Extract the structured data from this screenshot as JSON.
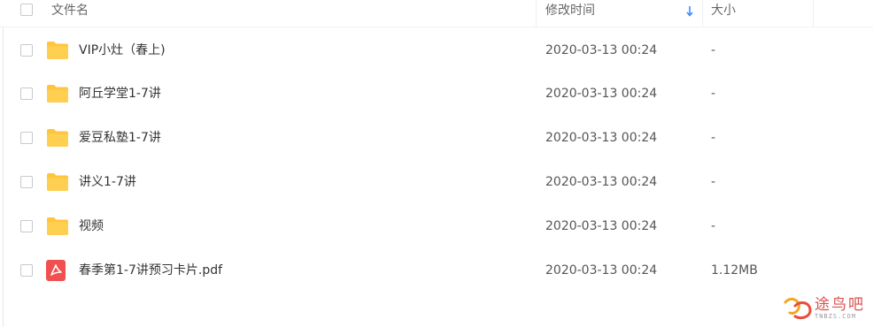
{
  "header": {
    "col_name": "文件名",
    "col_modified": "修改时间",
    "col_size": "大小"
  },
  "files": [
    {
      "name": "VIP小灶（春上)",
      "modified": "2020-03-13 00:24",
      "size": "-",
      "icon": "folder-icon"
    },
    {
      "name": "阿丘学堂1-7讲",
      "modified": "2020-03-13 00:24",
      "size": "-",
      "icon": "folder-icon"
    },
    {
      "name": "爱豆私塾1-7讲",
      "modified": "2020-03-13 00:24",
      "size": "-",
      "icon": "folder-icon"
    },
    {
      "name": "讲义1-7讲",
      "modified": "2020-03-13 00:24",
      "size": "-",
      "icon": "folder-icon"
    },
    {
      "name": "视频",
      "modified": "2020-03-13 00:24",
      "size": "-",
      "icon": "folder-icon"
    },
    {
      "name": "春季第1-7讲预习卡片.pdf",
      "modified": "2020-03-13 00:24",
      "size": "1.12MB",
      "icon": "pdf-icon"
    }
  ],
  "watermark": {
    "text": "途鸟吧",
    "sub": "TNBZS.COM"
  },
  "colors": {
    "folder": "#ffc63d",
    "pdf": "#f0504f",
    "sort_arrow": "#3b8cff",
    "watermark": "#d9534f"
  }
}
